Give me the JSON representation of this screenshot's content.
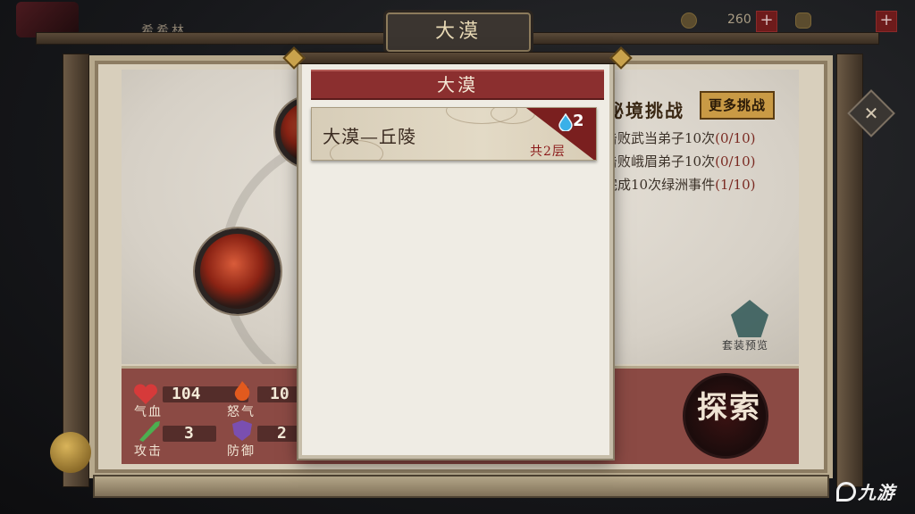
{
  "player": {
    "name": "希希林"
  },
  "currencies": [
    {
      "name": "copper",
      "value": "260"
    },
    {
      "name": "gold-ingot",
      "value": ""
    }
  ],
  "header": {
    "title": "大漠"
  },
  "challenge": {
    "title": "秘境挑战",
    "more_label": "更多挑战",
    "tasks": [
      {
        "text": "击败武当弟子10次",
        "progress": "(0/10)"
      },
      {
        "text": "击败峨眉弟子10次",
        "progress": "(0/10)"
      },
      {
        "text": "完成10次绿洲事件",
        "progress": "(1/10)"
      }
    ]
  },
  "outfit_preview_label": "套装预览",
  "stats": [
    {
      "label": "气血",
      "value": "104",
      "icon": "heart-icon",
      "color": "#d63a3a"
    },
    {
      "label": "怒气",
      "value": "10",
      "icon": "flame-icon",
      "color": "#e25a1e"
    },
    {
      "label": "攻击",
      "value": "3",
      "icon": "sword-icon",
      "color": "#4caf50"
    },
    {
      "label": "防御",
      "value": "2",
      "icon": "shield-icon",
      "color": "#7a4fb0"
    }
  ],
  "explore_label": "探索",
  "modal": {
    "title": "大漠",
    "levels": [
      {
        "name": "大漠—丘陵",
        "count": "2",
        "floors": "共2层"
      }
    ]
  },
  "watermark": "九游",
  "colors": {
    "header_red": "#8b2f2f",
    "stats_bg": "#8b4a44",
    "parchment": "#efece4"
  }
}
